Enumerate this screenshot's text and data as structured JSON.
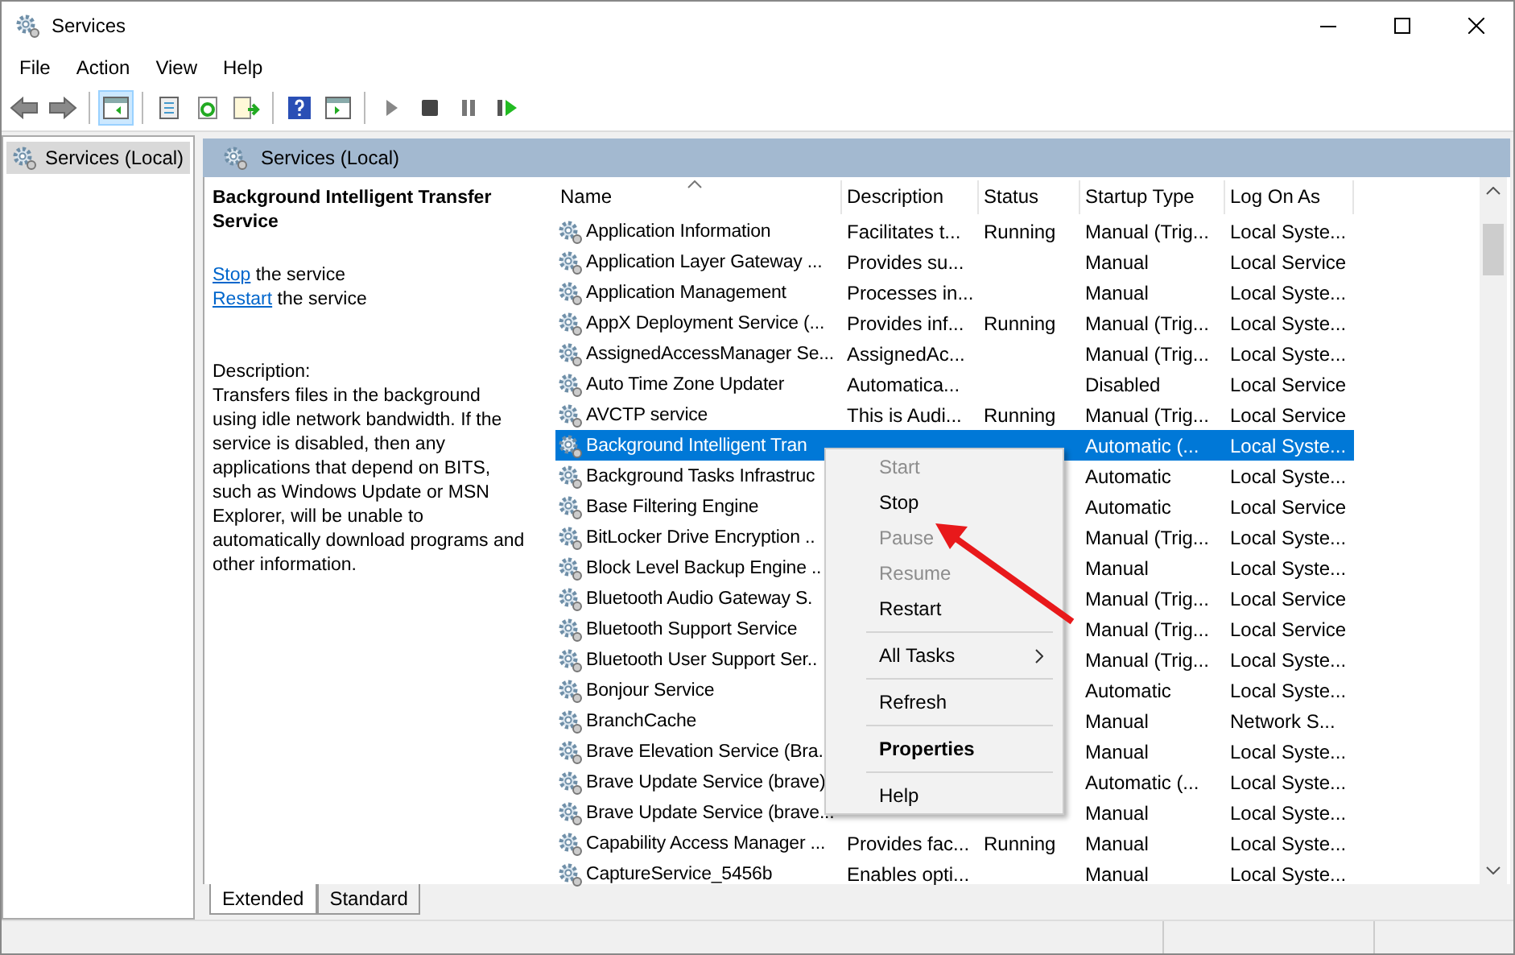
{
  "window": {
    "title": "Services"
  },
  "menu": [
    "File",
    "Action",
    "View",
    "Help"
  ],
  "tree": [
    {
      "label": "Services (Local)",
      "selected": true
    }
  ],
  "panel_header": "Services (Local)",
  "details": {
    "title": "Background Intelligent Transfer Service",
    "actions": [
      {
        "link": "Stop",
        "text": "the service"
      },
      {
        "link": "Restart",
        "text": "the service"
      }
    ],
    "description_label": "Description:",
    "description": "Transfers files in the background using idle network bandwidth. If the service is disabled, then any applications that depend on BITS, such as Windows Update or MSN Explorer, will be unable to automatically download programs and other information."
  },
  "table": {
    "columns": [
      {
        "label": "Name",
        "sorted": true
      },
      {
        "label": "Description",
        "sorted": false
      },
      {
        "label": "Status",
        "sorted": false
      },
      {
        "label": "Startup Type",
        "sorted": false
      },
      {
        "label": "Log On As",
        "sorted": false
      }
    ],
    "rows": [
      {
        "name": "Application Information",
        "description": "Facilitates t...",
        "status": "Running",
        "startup": "Manual (Trig...",
        "logon": "Local Syste...",
        "selected": false
      },
      {
        "name": "Application Layer Gateway ...",
        "description": "Provides su...",
        "startup": "Manual",
        "logon": "Local Service",
        "selected": false
      },
      {
        "name": "Application Management",
        "description": "Processes in...",
        "startup": "Manual",
        "logon": "Local Syste...",
        "selected": false
      },
      {
        "name": "AppX Deployment Service (...",
        "description": "Provides inf...",
        "status": "Running",
        "startup": "Manual (Trig...",
        "logon": "Local Syste...",
        "selected": false
      },
      {
        "name": "AssignedAccessManager Se...",
        "description": "AssignedAc...",
        "startup": "Manual (Trig...",
        "logon": "Local Syste...",
        "selected": false
      },
      {
        "name": "Auto Time Zone Updater",
        "description": "Automatica...",
        "startup": "Disabled",
        "logon": "Local Service",
        "selected": false
      },
      {
        "name": "AVCTP service",
        "description": "This is Audi...",
        "status": "Running",
        "startup": "Manual (Trig...",
        "logon": "Local Service",
        "selected": false
      },
      {
        "name": "Background Intelligent Tran",
        "startup": "Automatic (...",
        "logon": "Local Syste...",
        "selected": true
      },
      {
        "name": "Background Tasks Infrastruc",
        "startup": "Automatic",
        "logon": "Local Syste...",
        "selected": false
      },
      {
        "name": "Base Filtering Engine",
        "startup": "Automatic",
        "logon": "Local Service",
        "selected": false
      },
      {
        "name": "BitLocker Drive Encryption ..",
        "startup": "Manual (Trig...",
        "logon": "Local Syste...",
        "selected": false
      },
      {
        "name": "Block Level Backup Engine ..",
        "startup": "Manual",
        "logon": "Local Syste...",
        "selected": false
      },
      {
        "name": "Bluetooth Audio Gateway S.",
        "startup": "Manual (Trig...",
        "logon": "Local Service",
        "selected": false
      },
      {
        "name": "Bluetooth Support Service",
        "startup": "Manual (Trig...",
        "logon": "Local Service",
        "selected": false
      },
      {
        "name": "Bluetooth User Support Ser..",
        "startup": "Manual (Trig...",
        "logon": "Local Syste...",
        "selected": false
      },
      {
        "name": "Bonjour Service",
        "startup": "Automatic",
        "logon": "Local Syste...",
        "selected": false
      },
      {
        "name": "BranchCache",
        "startup": "Manual",
        "logon": "Network S...",
        "selected": false
      },
      {
        "name": "Brave Elevation Service (Bra.",
        "startup": "Manual",
        "logon": "Local Syste...",
        "selected": false
      },
      {
        "name": "Brave Update Service (brave)",
        "startup": "Automatic (...",
        "logon": "Local Syste...",
        "selected": false
      },
      {
        "name": "Brave Update Service (brave...",
        "startup": "Manual",
        "logon": "Local Syste...",
        "selected": false
      },
      {
        "name": "Capability Access Manager ...",
        "description": "Provides fac...",
        "status": "Running",
        "startup": "Manual",
        "logon": "Local Syste...",
        "selected": false
      },
      {
        "name": "CaptureService_5456b",
        "description": "Enables opti...",
        "startup": "Manual",
        "logon": "Local Syste...",
        "selected": false
      }
    ]
  },
  "context_menu": {
    "groups": [
      [
        {
          "label": "Start",
          "disabled": true,
          "default": false,
          "submenu": false
        },
        {
          "label": "Stop",
          "disabled": false,
          "default": false,
          "submenu": false
        },
        {
          "label": "Pause",
          "disabled": true,
          "default": false,
          "submenu": false
        },
        {
          "label": "Resume",
          "disabled": true,
          "default": false,
          "submenu": false
        },
        {
          "label": "Restart",
          "disabled": false,
          "default": false,
          "submenu": false
        }
      ],
      [
        {
          "label": "All Tasks",
          "disabled": false,
          "default": false,
          "submenu": true
        }
      ],
      [
        {
          "label": "Refresh",
          "disabled": false,
          "default": false,
          "submenu": false
        }
      ],
      [
        {
          "label": "Properties",
          "disabled": false,
          "default": true,
          "submenu": false
        }
      ],
      [
        {
          "label": "Help",
          "disabled": false,
          "default": false,
          "submenu": false
        }
      ]
    ]
  },
  "tabs": [
    {
      "label": "Extended",
      "selected": true
    },
    {
      "label": "Standard",
      "selected": false
    }
  ]
}
